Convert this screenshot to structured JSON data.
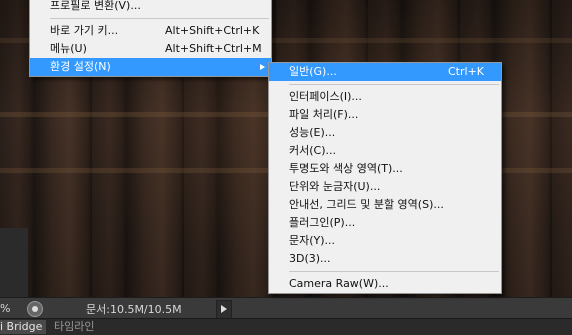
{
  "parent_menu": {
    "items": [
      {
        "label": "프로필로 변환(V)..."
      },
      {
        "label": "바로 가기 키...",
        "shortcut": "Alt+Shift+Ctrl+K"
      },
      {
        "label": "메뉴(U)",
        "shortcut": "Alt+Shift+Ctrl+M"
      },
      {
        "label": "환경 설정(N)",
        "selected": true,
        "has_submenu": true
      }
    ]
  },
  "submenu": {
    "title": "환경 설정(N)",
    "items": [
      {
        "label": "일반(G)...",
        "shortcut": "Ctrl+K",
        "selected": true
      },
      {
        "label": "인터페이스(I)..."
      },
      {
        "label": "파일 처리(F)..."
      },
      {
        "label": "성능(E)..."
      },
      {
        "label": "커서(C)..."
      },
      {
        "label": "투명도와 색상 영역(T)..."
      },
      {
        "label": "단위와 눈금자(U)..."
      },
      {
        "label": "안내선, 그리드 및 분할 영역(S)..."
      },
      {
        "label": "플러그인(P)..."
      },
      {
        "label": "문자(Y)..."
      },
      {
        "label": "3D(3)..."
      },
      {
        "label": "Camera Raw(W)..."
      }
    ]
  },
  "status_bar": {
    "zoom_suffix": "%",
    "document_size": "문서:10.5M/10.5M"
  },
  "bottom_tabs": [
    {
      "label": "i Bridge",
      "active": true
    },
    {
      "label": "타임라인",
      "active": false
    }
  ],
  "colors": {
    "menu_bg": "#f0f0f0",
    "selection": "#3399ff",
    "app_bg": "#282828"
  }
}
